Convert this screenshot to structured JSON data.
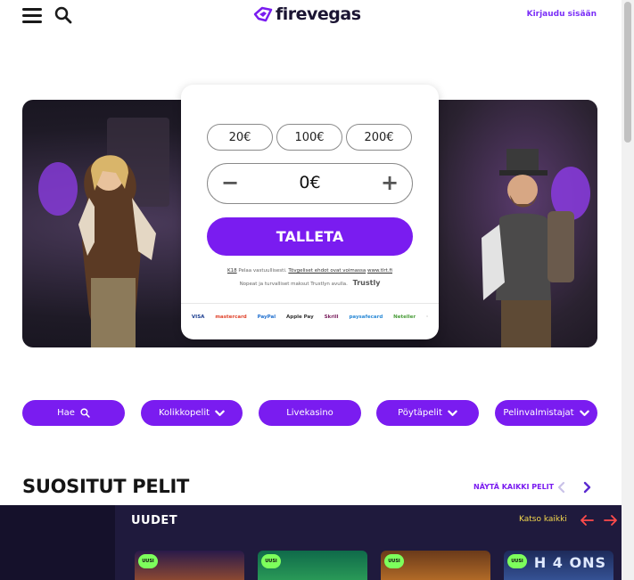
{
  "header": {
    "logo_text": "firevegas",
    "login_label": "Kirjaudu sisään"
  },
  "deposit": {
    "chips": [
      "20€",
      "100€",
      "200€"
    ],
    "amount_value": "0€",
    "minus_label": "−",
    "plus_label": "+",
    "button_label": "TALLETA",
    "legal_badge": "K18",
    "legal_text": "Pelaa vastuullisesti.",
    "legal_link1": "Tövgeliset ehdot ovat voimassa",
    "legal_link2": "www.tlrt.fi",
    "trustly_text": "Nopeat ja turvalliset maksut Trustlyn avulla.",
    "trustly_brand": "Trustly",
    "payment_methods": [
      "VISA",
      "mastercard",
      "PayPal",
      "Apple Pay",
      "Skrill",
      "paysafecard",
      "Neteller",
      "·"
    ]
  },
  "categories": [
    {
      "label": "Hae",
      "icon": "search-icon"
    },
    {
      "label": "Kolikkopelit",
      "icon": "chevron-down-icon"
    },
    {
      "label": "Livekasino",
      "icon": ""
    },
    {
      "label": "Pöytäpelit",
      "icon": "chevron-down-icon"
    },
    {
      "label": "Pelinvalmistajat",
      "icon": "chevron-down-icon"
    }
  ],
  "popular": {
    "title": "SUOSITUT PELIT",
    "show_all_label": "NÄYTÄ KAIKKI PELIT"
  },
  "new_games": {
    "title": "UUDET",
    "see_all_label": "Katso kaikki",
    "badge": "UUSI",
    "tile4_text": "H 4 ONS"
  },
  "colors": {
    "accent": "#7a1cf0",
    "dark_band": "#15112b",
    "yellow_link": "#f5d94e",
    "red_arrow": "#ff4b4b"
  }
}
